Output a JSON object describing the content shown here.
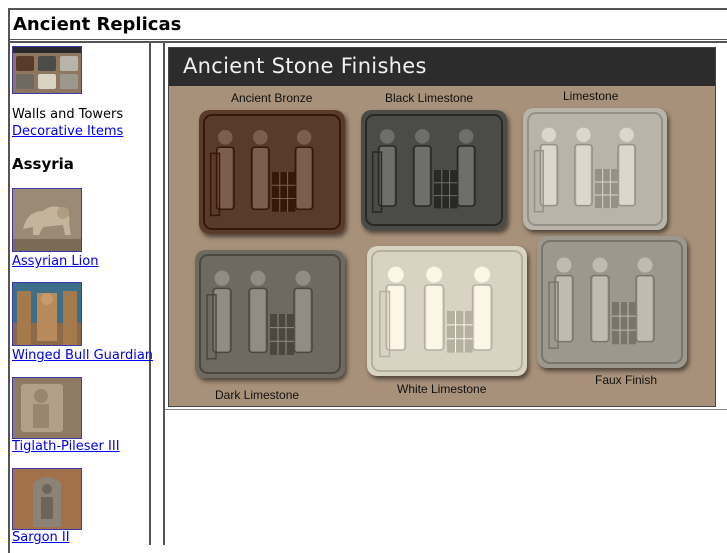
{
  "header": {
    "title": "Ancient Replicas"
  },
  "sidebar": {
    "walls_text": "Walls and Towers",
    "decorative_link": "Decorative Items",
    "section_heading": "Assyria",
    "items": [
      {
        "label": "Assyrian Lion",
        "icon": "lion-relief-thumbnail"
      },
      {
        "label": "Winged Bull Guardian",
        "icon": "winged-bull-thumbnail"
      },
      {
        "label": "Tiglath-Pileser III",
        "icon": "tiglath-pileser-thumbnail"
      },
      {
        "label": "Sargon II",
        "icon": "sargon-stele-thumbnail"
      }
    ]
  },
  "main": {
    "banner": "Ancient Stone Finishes",
    "plaques": [
      {
        "label": "Ancient Bronze",
        "color": "#5a3a2a"
      },
      {
        "label": "Black Limestone",
        "color": "#4b4b48"
      },
      {
        "label": "Limestone",
        "color": "#b8b4aa"
      },
      {
        "label": "Dark Limestone",
        "color": "#6e6a62"
      },
      {
        "label": "White Limestone",
        "color": "#d9d3c4"
      },
      {
        "label": "Faux Finish",
        "color": "#9c988e"
      }
    ]
  }
}
